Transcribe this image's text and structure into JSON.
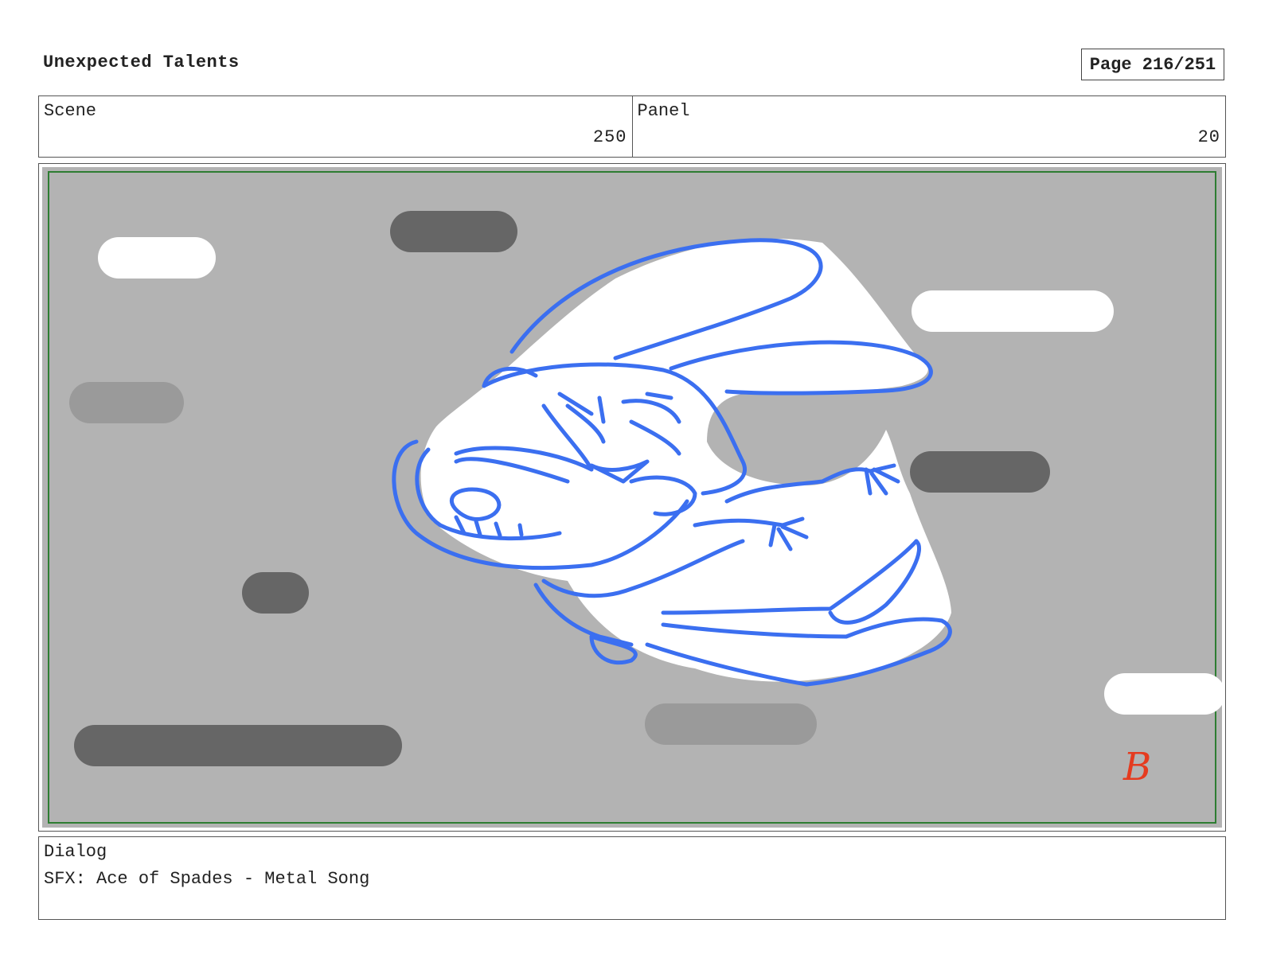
{
  "header": {
    "title": "Unexpected Talents",
    "page": "Page 216/251"
  },
  "info": {
    "scene_label": "Scene",
    "scene_value": "250",
    "panel_label": "Panel",
    "panel_value": "20"
  },
  "panel": {
    "background_color": "#b3b3b3",
    "frame_color": "#2e7d32",
    "line_color": "#3b6ff0",
    "signature_color": "#e53b1f",
    "signature": "B"
  },
  "dialog": {
    "label": "Dialog",
    "text": "SFX: Ace of Spades - Metal Song"
  }
}
